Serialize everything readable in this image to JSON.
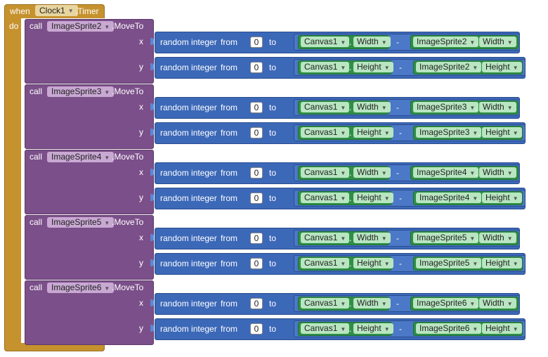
{
  "event": {
    "when_label": "when",
    "component": "Clock1",
    "event_name": ".Timer",
    "do_label": "do"
  },
  "calls": [
    {
      "call_label": "call",
      "sprite": "ImageSprite2",
      "method": ".MoveTo",
      "x": {
        "label": "x",
        "fn": "random integer",
        "from": "from",
        "from_val": "0",
        "to": "to",
        "a_comp": "Canvas1",
        "a_prop": "Width",
        "b_comp": "ImageSprite2",
        "b_prop": "Width"
      },
      "y": {
        "label": "y",
        "fn": "random integer",
        "from": "from",
        "from_val": "0",
        "to": "to",
        "a_comp": "Canvas1",
        "a_prop": "Height",
        "b_comp": "ImageSprite2",
        "b_prop": "Height"
      }
    },
    {
      "call_label": "call",
      "sprite": "ImageSprite3",
      "method": ".MoveTo",
      "x": {
        "label": "x",
        "fn": "random integer",
        "from": "from",
        "from_val": "0",
        "to": "to",
        "a_comp": "Canvas1",
        "a_prop": "Width",
        "b_comp": "ImageSprite3",
        "b_prop": "Width"
      },
      "y": {
        "label": "y",
        "fn": "random integer",
        "from": "from",
        "from_val": "0",
        "to": "to",
        "a_comp": "Canvas1",
        "a_prop": "Height",
        "b_comp": "ImageSprite3",
        "b_prop": "Height"
      }
    },
    {
      "call_label": "call",
      "sprite": "ImageSprite4",
      "method": ".MoveTo",
      "x": {
        "label": "x",
        "fn": "random integer",
        "from": "from",
        "from_val": "0",
        "to": "to",
        "a_comp": "Canvas1",
        "a_prop": "Width",
        "b_comp": "ImageSprite4",
        "b_prop": "Width"
      },
      "y": {
        "label": "y",
        "fn": "random integer",
        "from": "from",
        "from_val": "0",
        "to": "to",
        "a_comp": "Canvas1",
        "a_prop": "Height",
        "b_comp": "ImageSprite4",
        "b_prop": "Height"
      }
    },
    {
      "call_label": "call",
      "sprite": "ImageSprite5",
      "method": ".MoveTo",
      "x": {
        "label": "x",
        "fn": "random integer",
        "from": "from",
        "from_val": "0",
        "to": "to",
        "a_comp": "Canvas1",
        "a_prop": "Width",
        "b_comp": "ImageSprite5",
        "b_prop": "Width"
      },
      "y": {
        "label": "y",
        "fn": "random integer",
        "from": "from",
        "from_val": "0",
        "to": "to",
        "a_comp": "Canvas1",
        "a_prop": "Height",
        "b_comp": "ImageSprite5",
        "b_prop": "Height"
      }
    },
    {
      "call_label": "call",
      "sprite": "ImageSprite6",
      "method": ".MoveTo",
      "x": {
        "label": "x",
        "fn": "random integer",
        "from": "from",
        "from_val": "0",
        "to": "to",
        "a_comp": "Canvas1",
        "a_prop": "Width",
        "b_comp": "ImageSprite6",
        "b_prop": "Width"
      },
      "y": {
        "label": "y",
        "fn": "random integer",
        "from": "from",
        "from_val": "0",
        "to": "to",
        "a_comp": "Canvas1",
        "a_prop": "Height",
        "b_comp": "ImageSprite6",
        "b_prop": "Height"
      }
    }
  ],
  "minus_sign": "-",
  "dot": ".",
  "colors": {
    "event": "#c6922e",
    "procedure_call": "#7b4f89",
    "math": "#3c68b8",
    "component": "#2f8f45"
  },
  "icons": {
    "dropdown": "triangle-down-icon"
  }
}
